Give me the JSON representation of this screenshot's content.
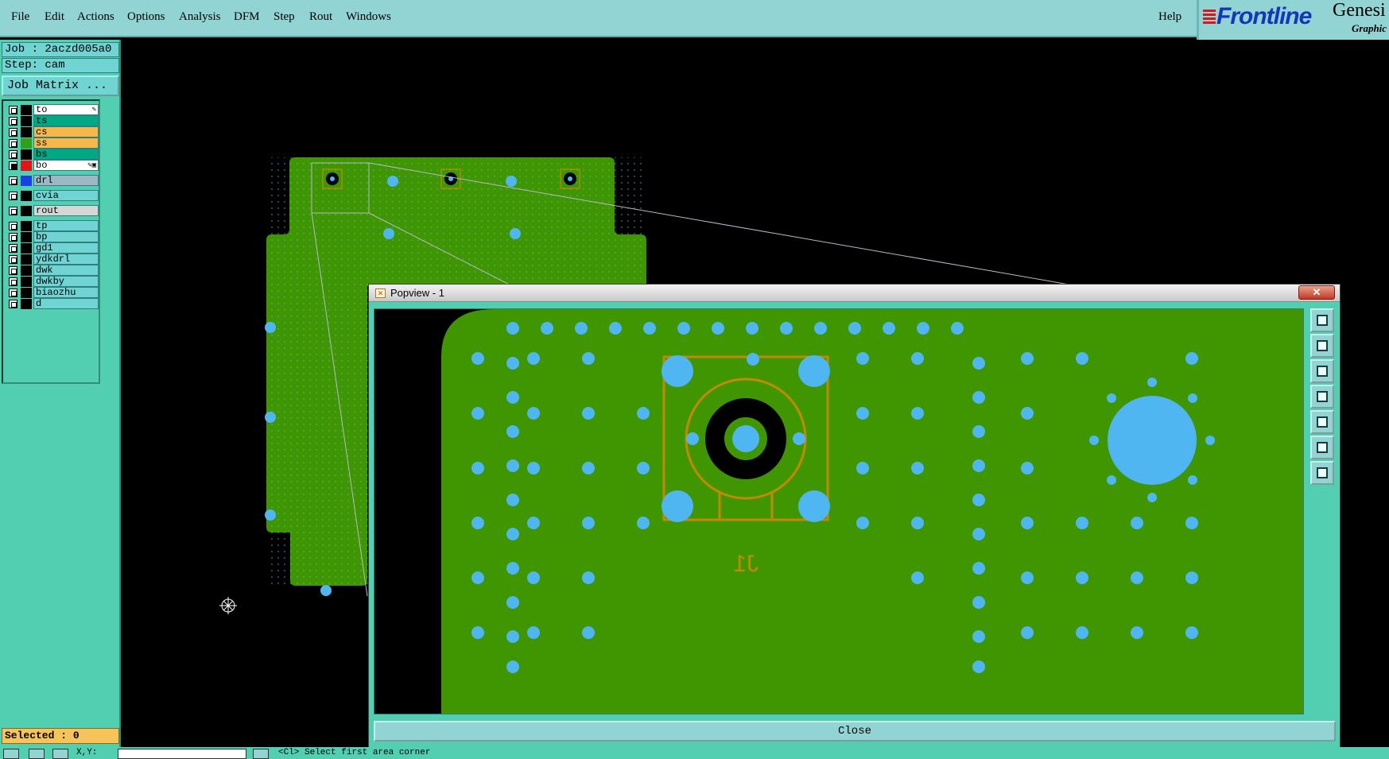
{
  "menu": {
    "items": [
      "File",
      "Edit",
      "Actions",
      "Options",
      "Analysis",
      "DFM",
      "Step",
      "Rout",
      "Windows"
    ],
    "help": "Help"
  },
  "brand": {
    "name": "Frontline",
    "product": "Genesi",
    "subtitle": "Graphic"
  },
  "job": {
    "job_label": "Job : 2aczd005a0",
    "step_label": "Step: cam",
    "matrix_button": "Job Matrix ..."
  },
  "layers": [
    {
      "name": "to",
      "color": "#ffffff",
      "swatch": "#000000",
      "checked": false,
      "mark": "✎"
    },
    {
      "name": "ts",
      "color": "#00a884",
      "swatch": "#000000",
      "checked": false,
      "mark": ""
    },
    {
      "name": "cs",
      "color": "#f6b84a",
      "swatch": "#000000",
      "checked": false,
      "mark": ""
    },
    {
      "name": "ss",
      "color": "#f6b84a",
      "swatch": "#2ea01c",
      "checked": false,
      "mark": ""
    },
    {
      "name": "bs",
      "color": "#00a884",
      "swatch": "#000000",
      "checked": false,
      "mark": ""
    },
    {
      "name": "bo",
      "color": "#ffffff",
      "swatch": "#e2141a",
      "checked": true,
      "mark": "✎▣"
    },
    {
      "name": "drl",
      "color": "#9fb7c4",
      "swatch": "#1b3fe0",
      "checked": false,
      "mark": ""
    },
    {
      "name": "cvia",
      "color": "#6fd4d2",
      "swatch": "#000000",
      "checked": false,
      "mark": ""
    },
    {
      "name": "rout",
      "color": "#d6d6d6",
      "swatch": "#000000",
      "checked": false,
      "mark": ""
    },
    {
      "name": "tp",
      "color": "#6fd4d2",
      "swatch": "#000000",
      "checked": false,
      "mark": ""
    },
    {
      "name": "bp",
      "color": "#6fd4d2",
      "swatch": "#000000",
      "checked": false,
      "mark": ""
    },
    {
      "name": "gd1",
      "color": "#6fd4d2",
      "swatch": "#000000",
      "checked": false,
      "mark": ""
    },
    {
      "name": "ydkdrl",
      "color": "#6fd4d2",
      "swatch": "#000000",
      "checked": false,
      "mark": ""
    },
    {
      "name": "dwk",
      "color": "#6fd4d2",
      "swatch": "#000000",
      "checked": false,
      "mark": ""
    },
    {
      "name": "dwkby",
      "color": "#6fd4d2",
      "swatch": "#000000",
      "checked": false,
      "mark": ""
    },
    {
      "name": "biaozhu",
      "color": "#6fd4d2",
      "swatch": "#000000",
      "checked": false,
      "mark": ""
    },
    {
      "name": "d",
      "color": "#6fd4d2",
      "swatch": "#000000",
      "checked": false,
      "mark": ""
    }
  ],
  "selected": "Selected : 0",
  "status": {
    "xy_label": "X,Y:",
    "message": "<Cl>  Select first area corner"
  },
  "popview": {
    "title": "Popview - 1",
    "close_label": "Close",
    "close_x": "✕",
    "designator": "J1"
  },
  "colors": {
    "board": "#3f9600",
    "pad": "#4fb6f2",
    "outline": "#c38a00",
    "panel": "#52cfb1",
    "menubar": "#92d3d4"
  }
}
